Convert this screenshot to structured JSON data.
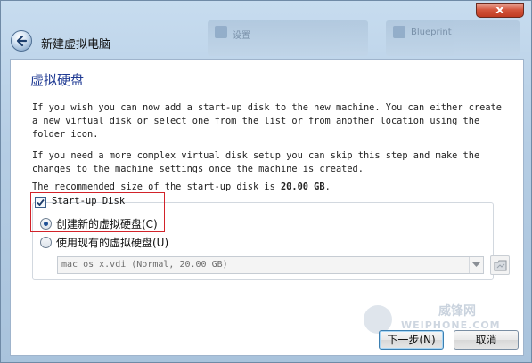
{
  "window": {
    "title": "新建虚拟电脑",
    "close_label": "x"
  },
  "background_windows": [
    {
      "label": "设置"
    },
    {
      "label": "Blueprint"
    }
  ],
  "page": {
    "heading": "虚拟硬盘",
    "paragraph1": "If you wish you can now add a start-up disk to the new machine. You can either create a new virtual disk or select one from the list or from another location using the folder icon.",
    "paragraph2": "If you need a more complex virtual disk setup you can skip this step and make the changes to the machine settings once the machine is created.",
    "recommended_prefix": "The recommended size of the start-up disk is ",
    "recommended_size": "20.00 GB",
    "recommended_suffix": "."
  },
  "startup_disk": {
    "label": "Start-up Disk",
    "checked": true,
    "options": [
      {
        "label": "创建新的虚拟硬盘(C)",
        "selected": true
      },
      {
        "label": "使用现有的虚拟硬盘(U)",
        "selected": false
      }
    ],
    "existing_disk_value": "mac os x.vdi (Normal, 20.00 GB)"
  },
  "watermark": {
    "main": "威锋网",
    "sub": "WEIPHONE.COM"
  },
  "buttons": {
    "next": "下一步(N)",
    "cancel": "取消"
  },
  "colors": {
    "heading": "#1f3a93",
    "highlight_border": "#d2232a",
    "close_button": "#c03b22"
  },
  "icons": [
    "back-arrow-icon",
    "close-icon",
    "checkbox-check-icon",
    "chevron-down-icon",
    "folder-icon"
  ]
}
